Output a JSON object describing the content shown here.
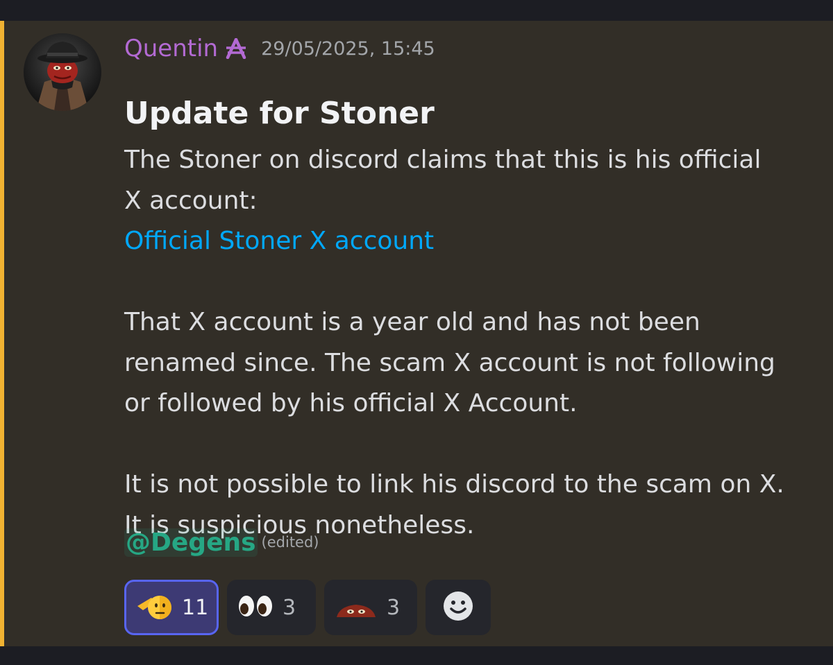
{
  "message": {
    "author": "Quentin",
    "role_icon": "aptos-icon",
    "timestamp": "29/05/2025, 15:45",
    "title": "Update for Stoner",
    "lines": [
      "The Stoner on discord claims that this is his official",
      "X account:"
    ],
    "link_text": "Official Stoner X account",
    "paragraph2": [
      "That X account is a year old and has not been",
      "renamed since. The scam X account is not following",
      "or followed by his official X Account."
    ],
    "paragraph3": [
      "It is not possible to link his discord to the scam on X.",
      "It is suspicious nonetheless."
    ],
    "mention": "@Degens",
    "edited_label": "(edited)"
  },
  "reactions": [
    {
      "icon": "saluting-face-emoji",
      "count": "11",
      "active": true
    },
    {
      "icon": "eyes-emoji",
      "count": "3",
      "active": false
    },
    {
      "icon": "peeking-custom-emoji",
      "count": "3",
      "active": false
    },
    {
      "icon": "add-reaction-icon",
      "count": "",
      "active": false
    }
  ],
  "colors": {
    "username": "#b36ad3",
    "link": "#00a8fc",
    "mention": "#26a784",
    "highlight_bar": "#f0b232",
    "message_bg": "#322e27"
  }
}
